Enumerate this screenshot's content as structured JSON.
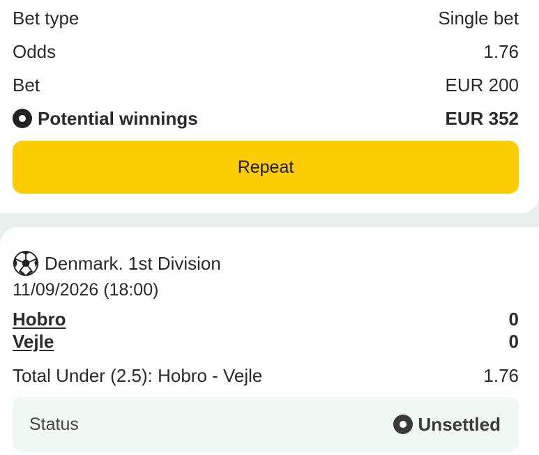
{
  "summary": {
    "bet_type_label": "Bet type",
    "bet_type_value": "Single bet",
    "odds_label": "Odds",
    "odds_value": "1.76",
    "bet_label": "Bet",
    "bet_value": "EUR 200",
    "winnings_label": "Potential winnings",
    "winnings_value": "EUR 352",
    "repeat_label": "Repeat"
  },
  "event": {
    "league": "Denmark. 1st Division",
    "datetime": "11/09/2026 (18:00)",
    "home_team": "Hobro",
    "home_score": "0",
    "away_team": "Vejle",
    "away_score": "0",
    "market": "Total Under (2.5): Hobro - Vejle",
    "market_odds": "1.76",
    "status_label": "Status",
    "status_value": "Unsettled"
  },
  "colors": {
    "accent_button": "#fbcb04",
    "page_background": "#e9efec",
    "status_background": "#f1f8f4"
  },
  "icons": {
    "winnings": "radio-dot-icon",
    "sport": "soccer-ball-icon",
    "status": "radio-dot-icon"
  }
}
